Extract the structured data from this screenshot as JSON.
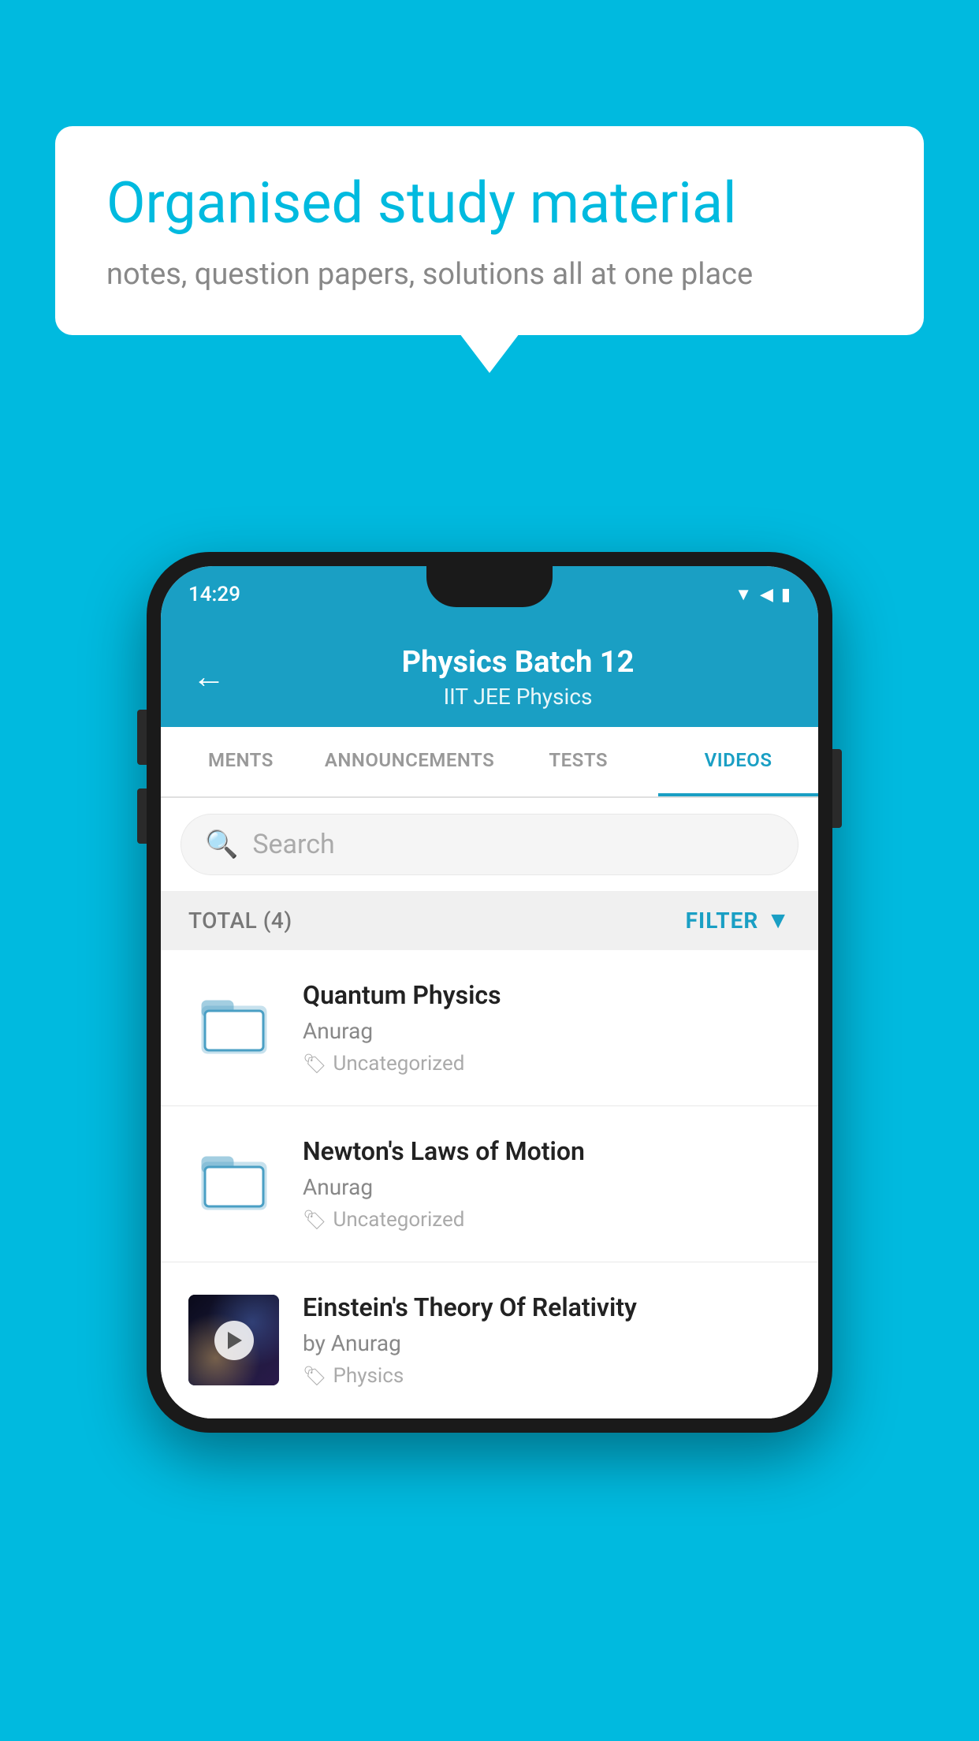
{
  "background_color": "#00BADF",
  "speech_bubble": {
    "title": "Organised study material",
    "subtitle": "notes, question papers, solutions all at one place"
  },
  "phone": {
    "status_bar": {
      "time": "14:29",
      "icons": [
        "wifi",
        "signal",
        "battery"
      ]
    },
    "header": {
      "title": "Physics Batch 12",
      "subtitle": "IIT JEE   Physics",
      "back_label": "←"
    },
    "tabs": [
      {
        "label": "MENTS",
        "active": false
      },
      {
        "label": "ANNOUNCEMENTS",
        "active": false
      },
      {
        "label": "TESTS",
        "active": false
      },
      {
        "label": "VIDEOS",
        "active": true
      }
    ],
    "search": {
      "placeholder": "Search"
    },
    "filter_bar": {
      "total_label": "TOTAL (4)",
      "filter_label": "FILTER"
    },
    "videos": [
      {
        "id": 1,
        "title": "Quantum Physics",
        "author": "Anurag",
        "tag": "Uncategorized",
        "type": "folder"
      },
      {
        "id": 2,
        "title": "Newton's Laws of Motion",
        "author": "Anurag",
        "tag": "Uncategorized",
        "type": "folder"
      },
      {
        "id": 3,
        "title": "Einstein's Theory Of Relativity",
        "author": "by Anurag",
        "tag": "Physics",
        "type": "video"
      }
    ]
  }
}
